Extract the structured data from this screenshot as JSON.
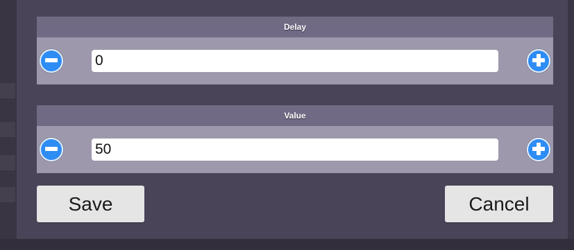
{
  "dialog": {
    "fields": [
      {
        "label": "Delay",
        "value": "0"
      },
      {
        "label": "Value",
        "value": "50"
      }
    ],
    "save_label": "Save",
    "cancel_label": "Cancel"
  },
  "colors": {
    "dialog_background": "#4a4458",
    "section_header": "#716a85",
    "section_body": "#9e98ac",
    "stepper_button": "#2e8df5"
  },
  "icons": [
    "minus-circle-icon",
    "plus-circle-icon"
  ]
}
